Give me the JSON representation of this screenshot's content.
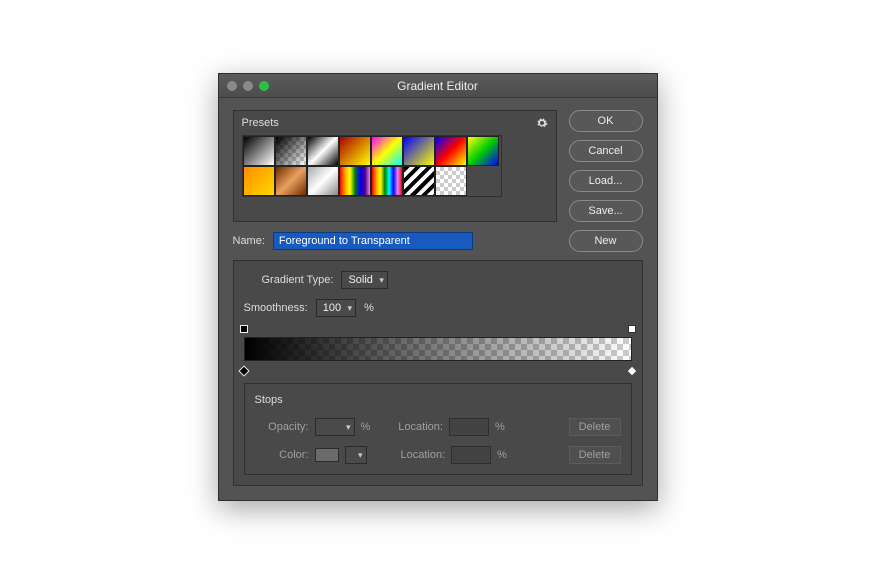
{
  "title": "Gradient Editor",
  "presets_label": "Presets",
  "buttons": {
    "ok": "OK",
    "cancel": "Cancel",
    "load": "Load...",
    "save": "Save...",
    "new": "New"
  },
  "name": {
    "label": "Name:",
    "value": "Foreground to Transparent"
  },
  "gradient_type": {
    "label": "Gradient Type:",
    "value": "Solid"
  },
  "smoothness": {
    "label": "Smoothness:",
    "value": "100",
    "unit": "%"
  },
  "stops": {
    "heading": "Stops",
    "opacity_label": "Opacity:",
    "opacity_unit": "%",
    "location_label": "Location:",
    "location_unit": "%",
    "color_label": "Color:",
    "delete": "Delete"
  },
  "presets": [
    "linear-gradient(135deg,#000,#fff)",
    "linear-gradient(135deg,#000 0%,rgba(0,0,0,0) 100%),repeating-conic-gradient(#ccc 0 25%,#fff 0 50%) 0 0/8px 8px",
    "linear-gradient(135deg,#000,#fff 50%,#000)",
    "linear-gradient(135deg,#a00,#ff0)",
    "linear-gradient(135deg,#f0f,#ff0,#0ff)",
    "linear-gradient(135deg,#00f,#ff0)",
    "linear-gradient(135deg,#00f,#f00,#ff0)",
    "linear-gradient(135deg,#ff0,#0c0,#00f)",
    "linear-gradient(135deg,#ff8c00,#ffd700)",
    "linear-gradient(135deg,#702800,#e9a15c,#702800)",
    "linear-gradient(135deg,#aaa,#fff,#888)",
    "linear-gradient(90deg,red,orange,yellow,green,blue,indigo,violet)",
    "linear-gradient(90deg,red,orange,yellow,green,cyan,blue,violet,red)",
    "repeating-linear-gradient(135deg,#000 0 4px,#fff 4px 8px)",
    "repeating-conic-gradient(#ccc 0 25%,#fff 0 50%) 0 0/8px 8px"
  ]
}
